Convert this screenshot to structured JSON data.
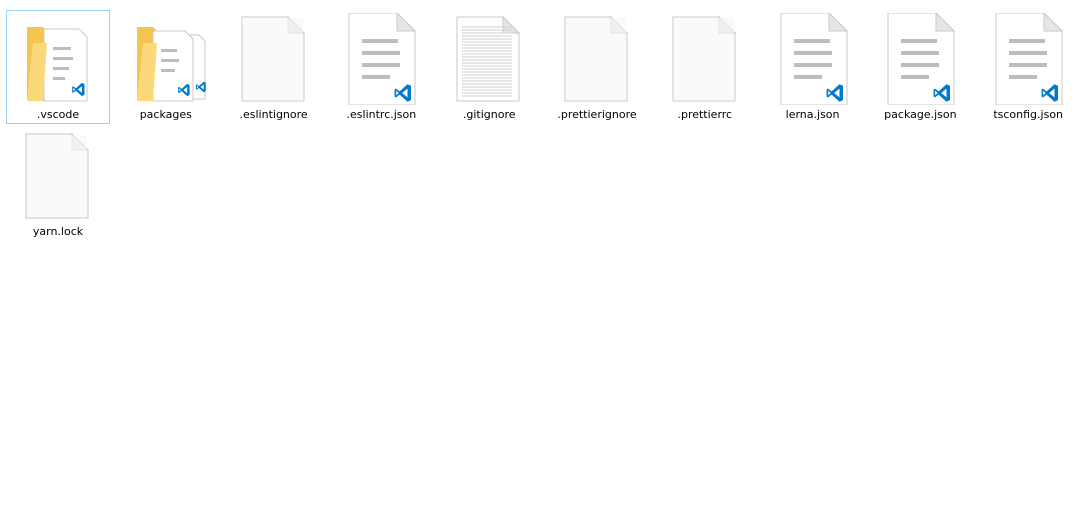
{
  "window": {
    "view": "Large icons"
  },
  "colors": {
    "selection_border": "#99d1ff",
    "folder_yellow": "#f5c64f",
    "folder_light": "#fbd97a",
    "page_fill": "#f7f7f7",
    "page_border": "#c9c9c9",
    "vscode_blue": "#007acc"
  },
  "files": [
    {
      "name": ".vscode",
      "kind": "folder",
      "icon": "folder-vscode-icon",
      "selected": true
    },
    {
      "name": "packages",
      "kind": "folder",
      "icon": "folder-multi-vscode-icon",
      "selected": false
    },
    {
      "name": ".eslintignore",
      "kind": "file",
      "icon": "blank-file-icon",
      "selected": false
    },
    {
      "name": ".eslintrc.json",
      "kind": "file",
      "icon": "vscode-json-file-icon",
      "selected": false
    },
    {
      "name": ".gitignore",
      "kind": "file",
      "icon": "text-file-icon",
      "selected": false
    },
    {
      "name": ".prettierignore",
      "kind": "file",
      "icon": "blank-file-icon",
      "selected": false
    },
    {
      "name": ".prettierrc",
      "kind": "file",
      "icon": "blank-file-icon",
      "selected": false
    },
    {
      "name": "lerna.json",
      "kind": "file",
      "icon": "vscode-json-file-icon",
      "selected": false
    },
    {
      "name": "package.json",
      "kind": "file",
      "icon": "vscode-json-file-icon",
      "selected": false
    },
    {
      "name": "tsconfig.json",
      "kind": "file",
      "icon": "vscode-json-file-icon",
      "selected": false
    },
    {
      "name": "yarn.lock",
      "kind": "file",
      "icon": "blank-file-icon",
      "selected": false
    }
  ]
}
